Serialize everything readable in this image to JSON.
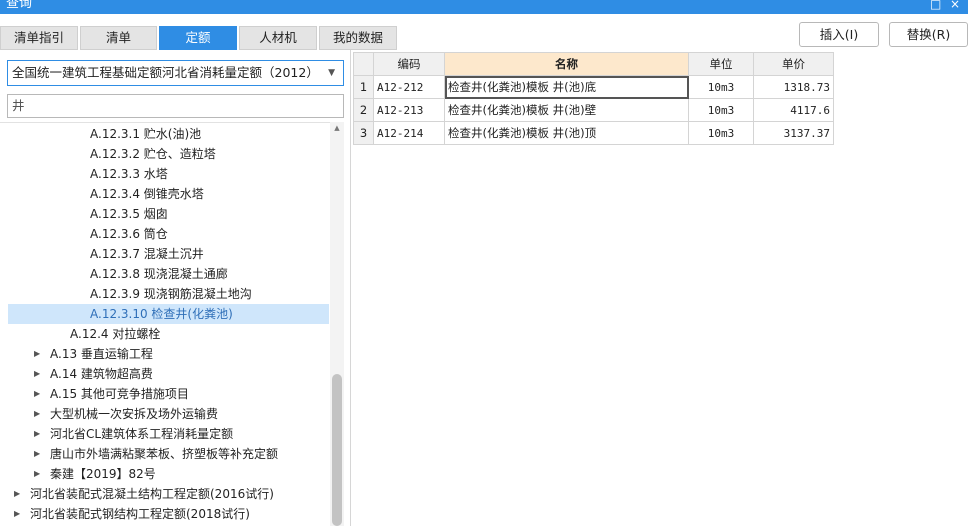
{
  "window": {
    "title": "查询",
    "restore_glyph": "□",
    "close_glyph": "×"
  },
  "tabs": [
    {
      "label": "清单指引",
      "active": false
    },
    {
      "label": "清单",
      "active": false
    },
    {
      "label": "定额",
      "active": true
    },
    {
      "label": "人材机",
      "active": false
    },
    {
      "label": "我的数据",
      "active": false
    }
  ],
  "toolbar": {
    "insert_label": "插入(I)",
    "replace_label": "替换(R)"
  },
  "left": {
    "quota_library": "全国统一建筑工程基础定额河北省消耗量定额（2012）",
    "search_value": "井"
  },
  "tree": [
    {
      "label": "A.12.3.1 贮水(油)池",
      "level": 3,
      "arrow": false,
      "selected": false
    },
    {
      "label": "A.12.3.2 贮仓、造粒塔",
      "level": 3,
      "arrow": false,
      "selected": false
    },
    {
      "label": "A.12.3.3 水塔",
      "level": 3,
      "arrow": false,
      "selected": false
    },
    {
      "label": "A.12.3.4 倒锥壳水塔",
      "level": 3,
      "arrow": false,
      "selected": false
    },
    {
      "label": "A.12.3.5 烟囱",
      "level": 3,
      "arrow": false,
      "selected": false
    },
    {
      "label": "A.12.3.6 筒仓",
      "level": 3,
      "arrow": false,
      "selected": false
    },
    {
      "label": "A.12.3.7 混凝土沉井",
      "level": 3,
      "arrow": false,
      "selected": false
    },
    {
      "label": "A.12.3.8 现浇混凝土通廊",
      "level": 3,
      "arrow": false,
      "selected": false
    },
    {
      "label": "A.12.3.9 现浇钢筋混凝土地沟",
      "level": 3,
      "arrow": false,
      "selected": false
    },
    {
      "label": "A.12.3.10 检查井(化粪池)",
      "level": 3,
      "arrow": false,
      "selected": true
    },
    {
      "label": "A.12.4 对拉螺栓",
      "level": 2,
      "arrow": false,
      "selected": false
    },
    {
      "label": "A.13 垂直运输工程",
      "level": 1,
      "arrow": true,
      "selected": false
    },
    {
      "label": "A.14 建筑物超高费",
      "level": 1,
      "arrow": true,
      "selected": false
    },
    {
      "label": "A.15 其他可竞争措施项目",
      "level": 1,
      "arrow": true,
      "selected": false
    },
    {
      "label": "大型机械一次安拆及场外运输费",
      "level": 1,
      "arrow": true,
      "selected": false
    },
    {
      "label": "河北省CL建筑体系工程消耗量定额",
      "level": 1,
      "arrow": true,
      "selected": false
    },
    {
      "label": "唐山市外墙满粘聚苯板、挤塑板等补充定额",
      "level": 1,
      "arrow": true,
      "selected": false
    },
    {
      "label": "秦建【2019】82号",
      "level": 1,
      "arrow": true,
      "selected": false
    },
    {
      "label": "河北省装配式混凝土结构工程定额(2016试行)",
      "level": 0,
      "arrow": true,
      "selected": false
    },
    {
      "label": "河北省装配式钢结构工程定额(2018试行)",
      "level": 0,
      "arrow": true,
      "selected": false
    }
  ],
  "grid": {
    "columns": [
      "编码",
      "名称",
      "单位",
      "单价"
    ],
    "rows": [
      {
        "num": "1",
        "code": "A12-212",
        "name": "检查井(化粪池)模板 井(池)底",
        "unit": "10m3",
        "price": "1318.73"
      },
      {
        "num": "2",
        "code": "A12-213",
        "name": "检查井(化粪池)模板 井(池)壁",
        "unit": "10m3",
        "price": "4117.6"
      },
      {
        "num": "3",
        "code": "A12-214",
        "name": "检查井(化粪池)模板 井(池)顶",
        "unit": "10m3",
        "price": "3137.37"
      }
    ]
  },
  "icons": {
    "tree_arrow": "▶",
    "dropdown_caret": "▼",
    "scroll_up": "▲"
  },
  "colors": {
    "accent": "#2f8de4",
    "selected_row": "#cfe6fb",
    "name_header": "#fde8cc"
  }
}
